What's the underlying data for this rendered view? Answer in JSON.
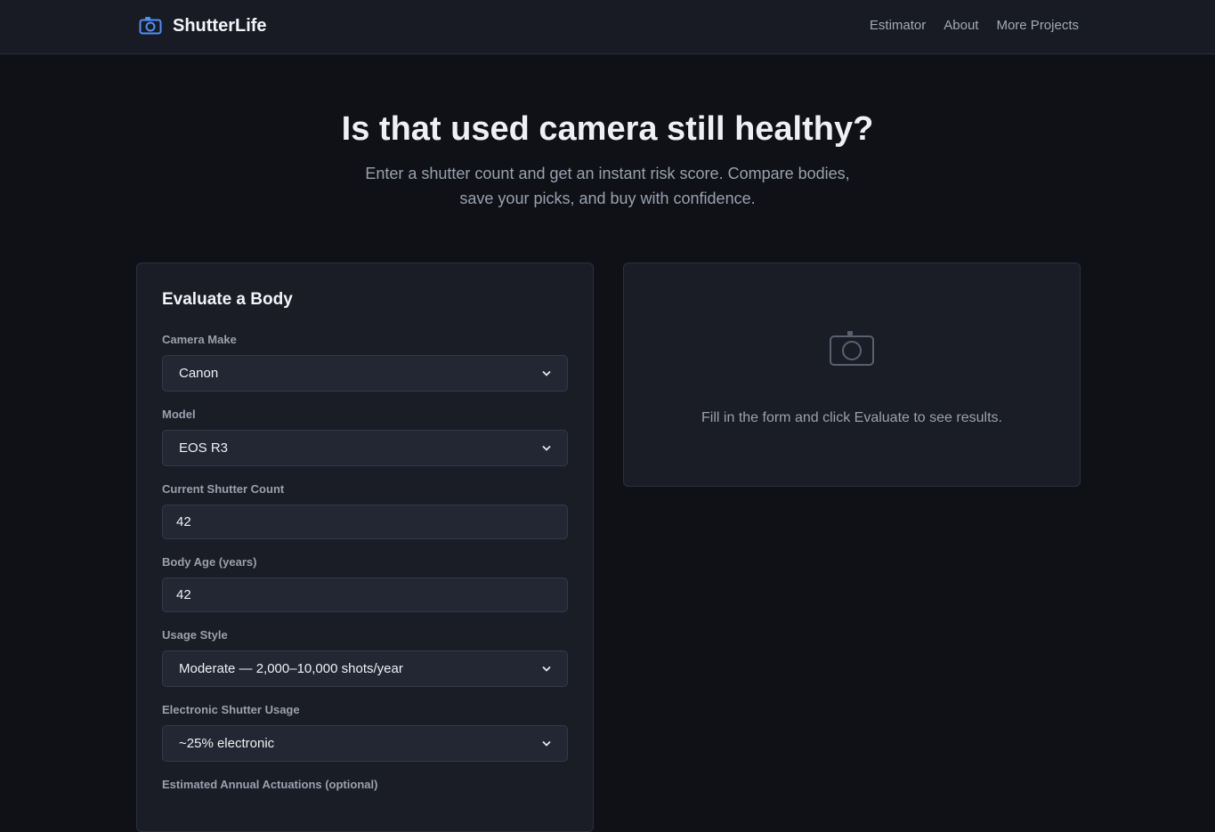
{
  "brand": {
    "name": "ShutterLife",
    "icon": "camera-icon",
    "accent": "#4f8ff7"
  },
  "nav": {
    "links": [
      "Estimator",
      "About",
      "More Projects"
    ]
  },
  "hero": {
    "title": "Is that used camera still healthy?",
    "subtitle": "Enter a shutter count and get an instant risk score. Compare bodies, save your picks, and buy with confidence."
  },
  "form": {
    "title": "Evaluate a Body",
    "make": {
      "label": "Camera Make",
      "value": "Canon"
    },
    "model": {
      "label": "Model",
      "value": "EOS R3"
    },
    "shutter_count": {
      "label": "Current Shutter Count",
      "value": "42"
    },
    "body_age": {
      "label": "Body Age (years)",
      "value": "42"
    },
    "usage_style": {
      "label": "Usage Style",
      "value": "Moderate — 2,000–10,000 shots/year"
    },
    "electronic_shutter": {
      "label": "Electronic Shutter Usage",
      "value": "~25% electronic"
    },
    "annual_actuations": {
      "label": "Estimated Annual Actuations (optional)"
    }
  },
  "result": {
    "icon": "camera-icon",
    "message": "Fill in the form and click Evaluate to see results."
  }
}
